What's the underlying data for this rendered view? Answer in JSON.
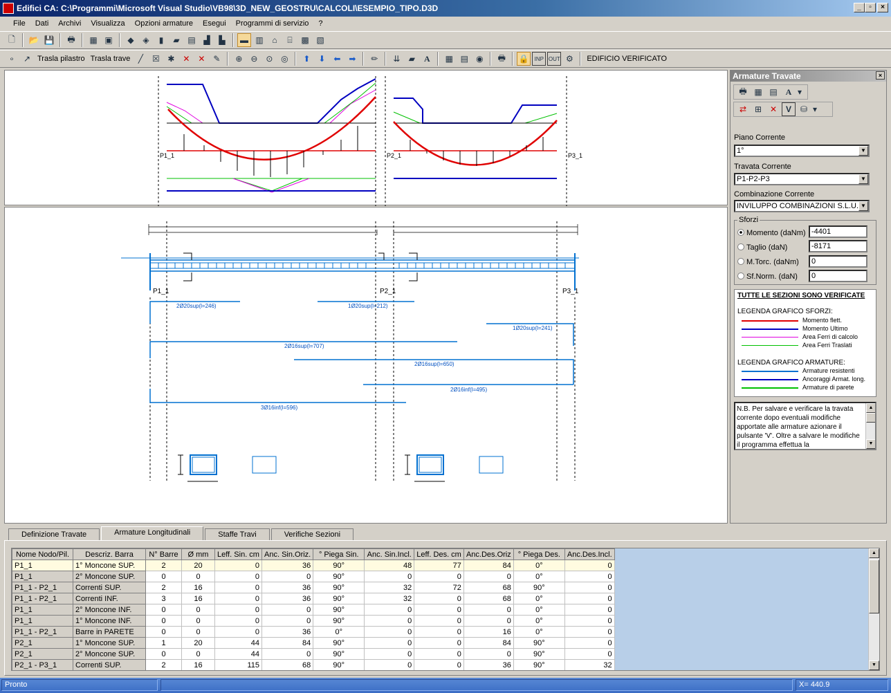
{
  "window": {
    "title": "Edifici CA:   C:\\Programmi\\Microsoft Visual Studio\\VB98\\3D_NEW_GEOSTRU\\CALCOLI\\ESEMPIO_TIPO.D3D"
  },
  "menu": [
    "File",
    "Dati",
    "Archivi",
    "Visualizza",
    "Opzioni armature",
    "Esegui",
    "Programmi di servizio",
    "?"
  ],
  "toolbar2": {
    "move_pillar": "Trasla pilastro",
    "move_beam": "Trasla trave",
    "status": "EDIFICIO VERIFICATO",
    "inp": "INP",
    "out": "OUT"
  },
  "top_drawing": {
    "label_p1": "P1_1",
    "label_p2": "P2_1",
    "label_p3": "P3_1"
  },
  "bottom_drawing": {
    "label_p1": "P1_1",
    "label_p2": "P2_1",
    "label_p3": "P3_1",
    "bars": [
      "2Ø20sup(l=246)",
      "1Ø20sup(l=212)",
      "1Ø20sup(l=241)",
      "2Ø16sup(l=707)",
      "2Ø16sup(l=650)",
      "2Ø16inf(l=495)",
      "3Ø16inf(l=596)"
    ]
  },
  "panel": {
    "title": "Armature Travate",
    "piano_label": "Piano Corrente",
    "piano_value": "1°",
    "travata_label": "Travata Corrente",
    "travata_value": "P1-P2-P3",
    "combinazione_label": "Combinazione Corrente",
    "combinazione_value": "INVILUPPO COMBINAZIONI  S.L.U.",
    "sforzi_label": "Sforzi",
    "momento_label": "Momento (daNm)",
    "momento_value": "-4401",
    "taglio_label": "Taglio  (daN)",
    "taglio_value": "-8171",
    "mtorc_label": "M.Torc. (daNm)",
    "mtorc_value": "0",
    "sfnorm_label": "Sf.Norm.  (daN)",
    "sfnorm_value": "0",
    "verified": "TUTTE LE SEZIONI SONO VERIFICATE",
    "legend_sforzi_title": "LEGENDA GRAFICO SFORZI:",
    "legend_sforzi": [
      {
        "label": "Momento flett.",
        "color": "#e00000"
      },
      {
        "label": "Momento Ultimo",
        "color": "#0000c0"
      },
      {
        "label": "Area Ferri di calcolo",
        "color": "#e000e0"
      },
      {
        "label": "Area Ferri Traslati",
        "color": "#00c000"
      }
    ],
    "legend_armature_title": "LEGENDA GRAFICO ARMATURE:",
    "legend_armature": [
      {
        "label": "Armature resistenti",
        "color": "#0070d0"
      },
      {
        "label": "Ancoraggi Armat. long.",
        "color": "#0000c0"
      },
      {
        "label": "Armature di parete",
        "color": "#00c000"
      }
    ],
    "note": "N.B.   Per salvare e verificare la travata corrente dopo eventuali modifiche apportate alle armature azionare il pulsante 'V'. Oltre a salvare le modifiche il programma effettua la"
  },
  "tabs": [
    "Definizione Travate",
    "Armature Longitudinali",
    "Staffe Travi",
    "Verifiche Sezioni"
  ],
  "grid": {
    "columns": [
      "Nome Nodo/Pil.",
      "Descriz. Barra",
      "N° Barre",
      "Ø  mm",
      "Leff. Sin. cm",
      "Anc. Sin.Oriz.",
      "° Piega Sin.",
      "Anc. Sin.Incl.",
      "Leff. Des. cm",
      "Anc.Des.Oriz",
      "° Piega Des.",
      "Anc.Des.Incl."
    ],
    "rows": [
      [
        "P1_1",
        "1° Moncone SUP.",
        "2",
        "20",
        "0",
        "36",
        "90°",
        "48",
        "77",
        "84",
        "0°",
        "0"
      ],
      [
        "P1_1",
        "2° Moncone SUP.",
        "0",
        "0",
        "0",
        "0",
        "90°",
        "0",
        "0",
        "0",
        "0°",
        "0"
      ],
      [
        "P1_1 - P2_1",
        "Correnti SUP.",
        "2",
        "16",
        "0",
        "36",
        "90°",
        "32",
        "72",
        "68",
        "90°",
        "0"
      ],
      [
        "P1_1 - P2_1",
        "Correnti  INF.",
        "3",
        "16",
        "0",
        "36",
        "90°",
        "32",
        "0",
        "68",
        "0°",
        "0"
      ],
      [
        "P1_1",
        "2° Moncone  INF.",
        "0",
        "0",
        "0",
        "0",
        "90°",
        "0",
        "0",
        "0",
        "0°",
        "0"
      ],
      [
        "P1_1",
        "1° Moncone  INF.",
        "0",
        "0",
        "0",
        "0",
        "90°",
        "0",
        "0",
        "0",
        "0°",
        "0"
      ],
      [
        "P1_1 - P2_1",
        "Barre in PARETE",
        "0",
        "0",
        "0",
        "36",
        "0°",
        "0",
        "0",
        "16",
        "0°",
        "0"
      ],
      [
        "P2_1",
        "1° Moncone SUP.",
        "1",
        "20",
        "44",
        "84",
        "90°",
        "0",
        "0",
        "84",
        "90°",
        "0"
      ],
      [
        "P2_1",
        "2° Moncone SUP.",
        "0",
        "0",
        "44",
        "0",
        "90°",
        "0",
        "0",
        "0",
        "90°",
        "0"
      ],
      [
        "P2_1 - P3_1",
        "Correnti SUP.",
        "2",
        "16",
        "115",
        "68",
        "90°",
        "0",
        "0",
        "36",
        "90°",
        "32"
      ]
    ]
  },
  "status": {
    "left": "Pronto",
    "coord": "X=  440.9"
  }
}
